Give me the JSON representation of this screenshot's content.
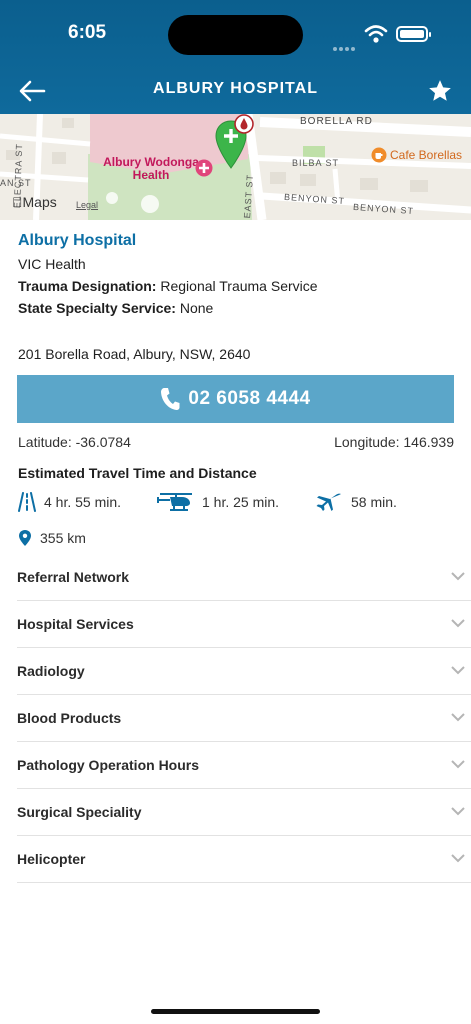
{
  "status": {
    "time": "6:05"
  },
  "header": {
    "title": "ALBURY HOSPITAL"
  },
  "map": {
    "brand": "Maps",
    "legal": "Legal",
    "hospital_label": "Albury Wodonga\nHealth",
    "cafe_label": "Cafe Borellas",
    "roads": {
      "borella": "BORELLA RD",
      "bilba": "BILBA ST",
      "benyon1": "BENYON ST",
      "benyon2": "BENYON ST",
      "electra": "ELECTRA ST",
      "east": "EAST ST",
      "an": "AN ST"
    }
  },
  "hospital": {
    "name": "Albury Hospital",
    "health": "VIC Health",
    "trauma_label": "Trauma Designation:",
    "trauma_value": "Regional Trauma Service",
    "specialty_label": "State Specialty Service:",
    "specialty_value": "None",
    "address": "201 Borella Road, Albury, NSW, 2640",
    "phone": "02 6058 4444",
    "latitude": "Latitude: -36.0784",
    "longitude": "Longitude: 146.939"
  },
  "travel": {
    "title": "Estimated Travel Time and Distance",
    "road": "4 hr. 55 min.",
    "helicopter": "1 hr. 25 min.",
    "plane": "58 min.",
    "distance": "355 km"
  },
  "sections": [
    {
      "label": "Referral Network"
    },
    {
      "label": "Hospital Services"
    },
    {
      "label": "Radiology"
    },
    {
      "label": "Blood Products"
    },
    {
      "label": "Pathology Operation Hours"
    },
    {
      "label": "Surgical Speciality"
    },
    {
      "label": "Helicopter"
    }
  ],
  "colors": {
    "header": "#0f6a9c",
    "accent": "#0d6fa5",
    "button": "#5ba6c9"
  }
}
